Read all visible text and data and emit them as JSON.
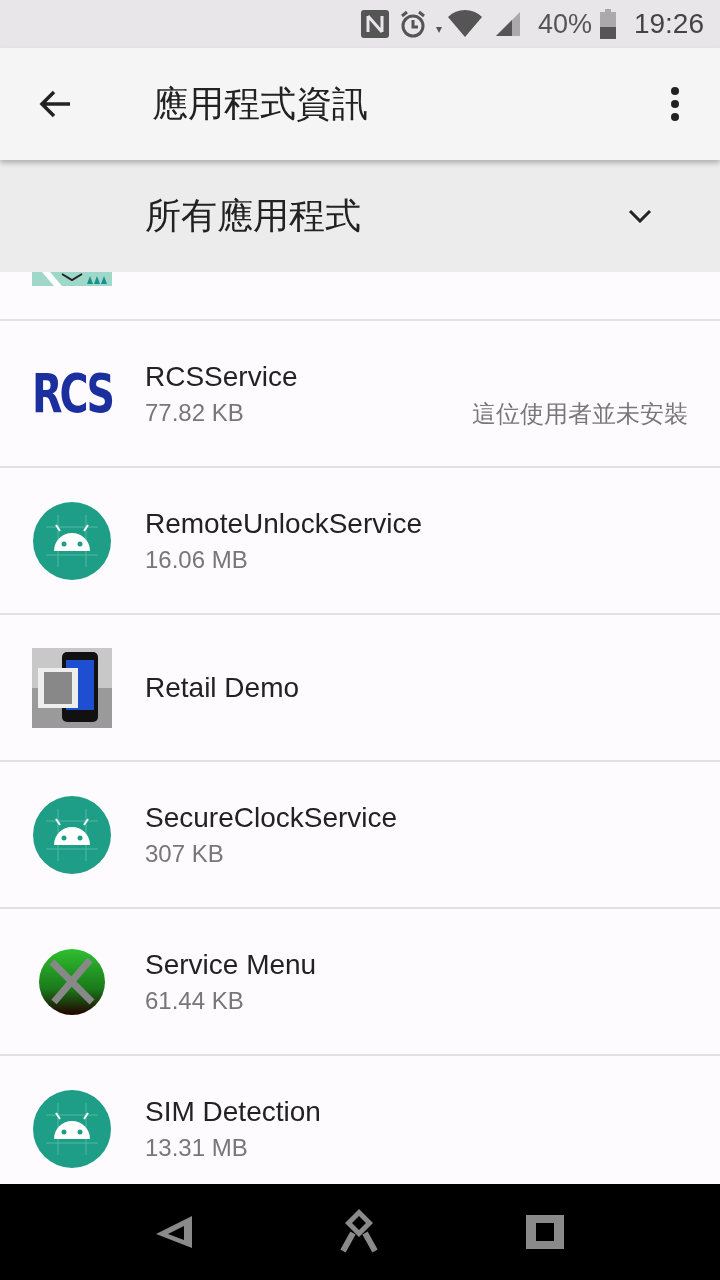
{
  "status_bar": {
    "battery_text": "40%",
    "time": "19:26"
  },
  "app_bar": {
    "title": "應用程式資訊"
  },
  "filter": {
    "label": "所有應用程式"
  },
  "apps": [
    {
      "kind": "logo",
      "logo_text": "RCS",
      "name": "RCSService",
      "size": "77.82 KB",
      "note": "這位使用者並未安裝"
    },
    {
      "kind": "android",
      "name": "RemoteUnlockService",
      "size": "16.06 MB"
    },
    {
      "kind": "retail",
      "name": "Retail Demo"
    },
    {
      "kind": "android",
      "name": "SecureClockService",
      "size": "307 KB"
    },
    {
      "kind": "tools",
      "name": "Service Menu",
      "size": "61.44 KB"
    },
    {
      "kind": "android",
      "name": "SIM Detection",
      "size": "13.31 MB"
    }
  ]
}
